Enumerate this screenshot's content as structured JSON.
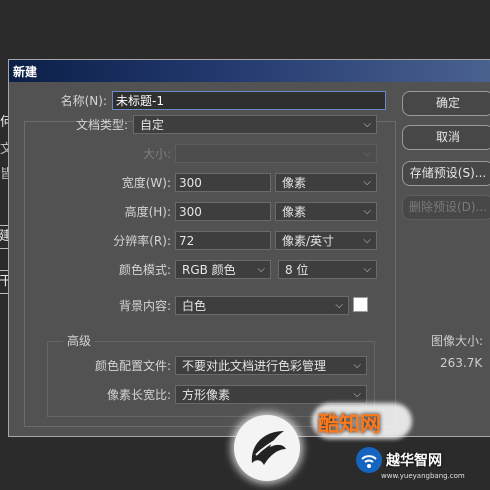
{
  "background_fragments": [
    "何",
    "文",
    "皆",
    "建",
    "干"
  ],
  "dialog": {
    "title": "新建",
    "name_label": "名称(N):",
    "name_value": "未标题-1",
    "doc_type_label": "文档类型:",
    "doc_type_value": "自定",
    "size_label": "大小:",
    "size_value": "",
    "width_label": "宽度(W):",
    "width_value": "300",
    "width_unit": "像素",
    "height_label": "高度(H):",
    "height_value": "300",
    "height_unit": "像素",
    "resolution_label": "分辨率(R):",
    "resolution_value": "72",
    "resolution_unit": "像素/英寸",
    "color_mode_label": "颜色模式:",
    "color_mode_value": "RGB 颜色",
    "bit_depth_value": "8 位",
    "background_label": "背景内容:",
    "background_value": "白色",
    "background_swatch_color": "#ffffff",
    "advanced_title": "高级",
    "color_profile_label": "颜色配置文件:",
    "color_profile_value": "不要对此文档进行色彩管理",
    "pixel_aspect_label": "像素长宽比:",
    "pixel_aspect_value": "方形像素",
    "buttons": {
      "ok": "确定",
      "cancel": "取消",
      "save_preset": "存储预设(S)...",
      "delete_preset": "删除预设(D)..."
    },
    "image_size_label": "图像大小:",
    "image_size_value": "263.7K"
  },
  "watermark": {
    "main_text": "酷知网",
    "site_name": "越华智网",
    "site_url": "www.yueyangbang.com"
  }
}
